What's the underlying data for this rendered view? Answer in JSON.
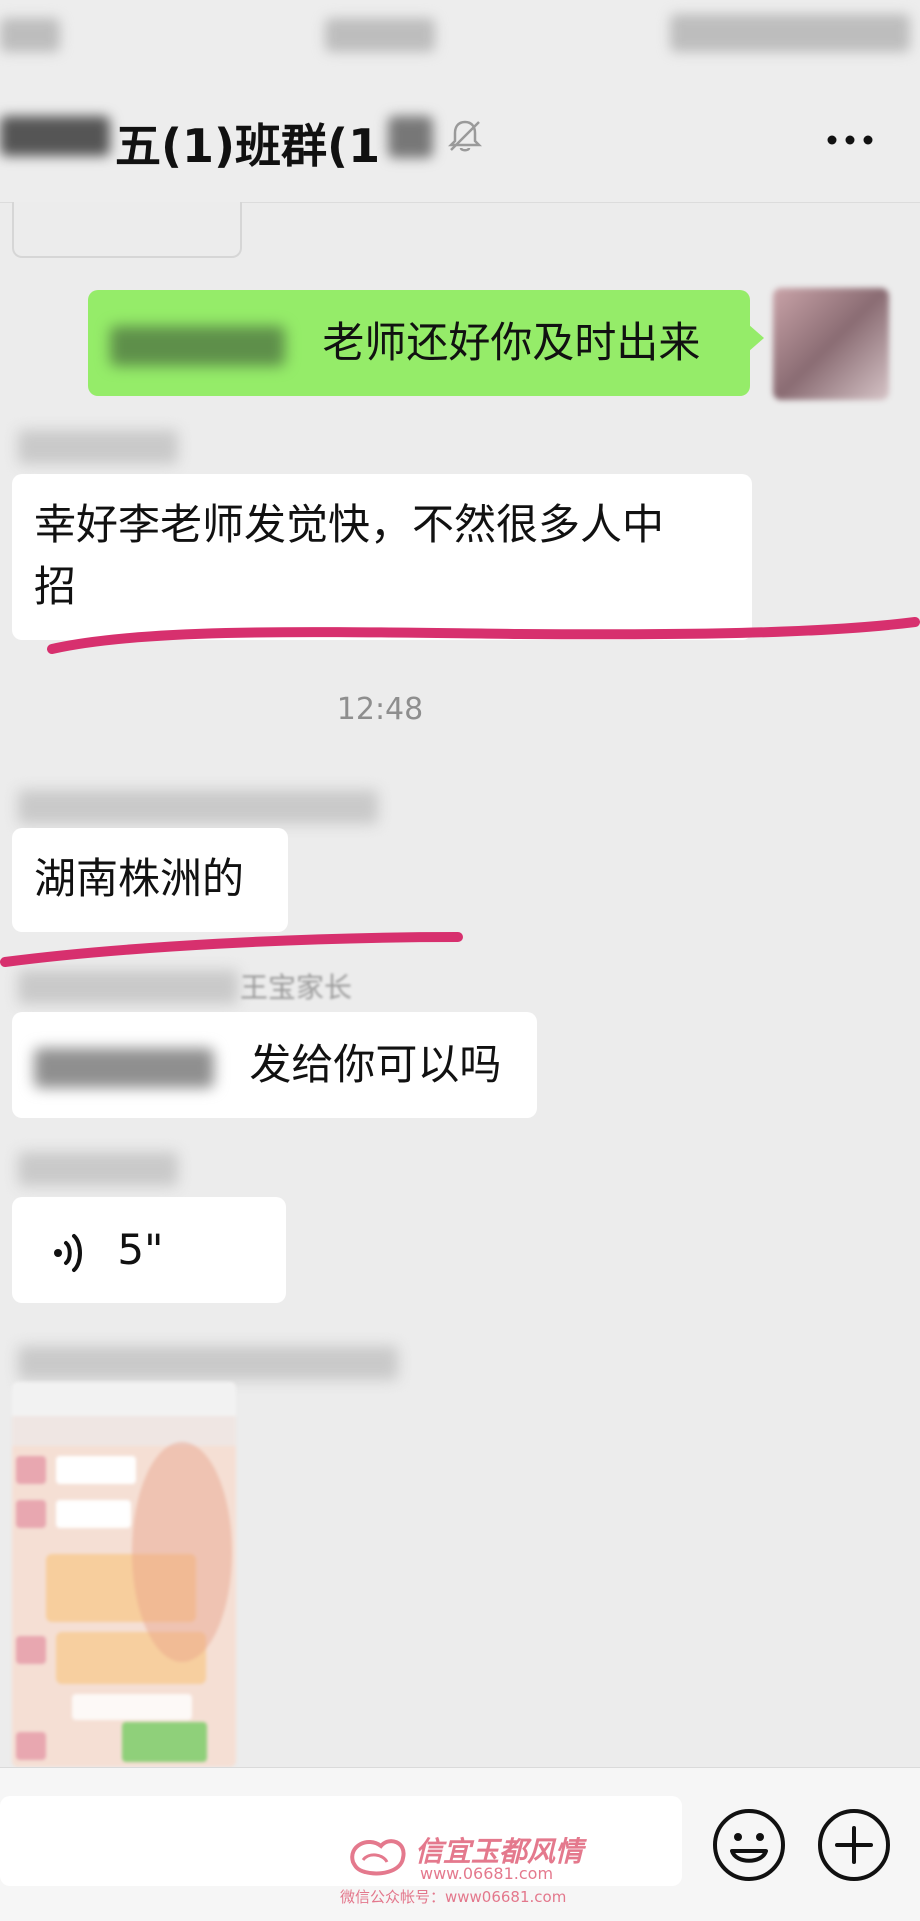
{
  "header": {
    "title": "五(1)班群(1",
    "more_label": "···"
  },
  "messages": {
    "m1_text": "老师还好你及时出来",
    "m2_text_line1": "幸好李老师发觉快，不然很多人中",
    "m2_text_line2": "招",
    "timestamp": "12:48",
    "m3_text": "湖南株洲的",
    "m4_sender": "王宝家长",
    "m4_text": "发给你可以吗",
    "m5_voice_duration": "5\""
  },
  "watermark": {
    "title": "信宜玉都风情",
    "url": "www.06681.com",
    "account": "微信公众帐号：www06681.com"
  },
  "colors": {
    "sent_bubble": "#95ec69",
    "received_bubble": "#ffffff",
    "background": "#ececec",
    "highlight_line": "#d7306e"
  }
}
